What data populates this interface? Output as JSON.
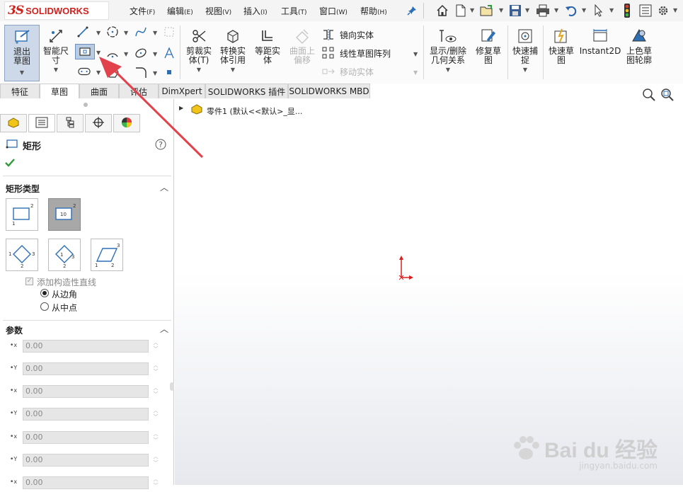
{
  "app": {
    "logo_ds": "3S",
    "logo_word": "SOLIDWORKS"
  },
  "menu": [
    {
      "label": "文件",
      "key": "(F)"
    },
    {
      "label": "编辑",
      "key": "(E)"
    },
    {
      "label": "视图",
      "key": "(V)"
    },
    {
      "label": "插入",
      "key": "(I)"
    },
    {
      "label": "工具",
      "key": "(T)"
    },
    {
      "label": "窗口",
      "key": "(W)"
    },
    {
      "label": "帮助",
      "key": "(H)"
    }
  ],
  "ribbon": {
    "exit_sketch": "退出草图",
    "smart_dim": "智能尺寸",
    "trim": "剪裁实体(T)",
    "convert": "转换实体引用",
    "offset": "等距实体",
    "offset_surface": "曲面上偏移",
    "mirror": "镜向实体",
    "linear_pattern": "线性草图阵列",
    "move": "移动实体",
    "display_relations": "显示/删除几何关系",
    "repair": "修复草图",
    "quick_snaps": "快速捕捉",
    "rapid_sketch": "快速草图",
    "instant2d": "Instant2D",
    "shaded_contours": "上色草图轮廓"
  },
  "tabs": [
    "特征",
    "草图",
    "曲面",
    "评估",
    "DimXpert",
    "SOLIDWORKS 插件",
    "SOLIDWORKS MBD"
  ],
  "tree": {
    "part_label": "零件1  (默认<<默认>_显..."
  },
  "panel": {
    "title": "矩形",
    "rect_type_title": "矩形类型",
    "construction_lines": "添加构造性直线",
    "from_corner": "从边角",
    "from_midpoint": "从中点",
    "params_title": "参数",
    "params": [
      {
        "axis": "x",
        "value": "0.00"
      },
      {
        "axis": "Y",
        "value": "0.00"
      },
      {
        "axis": "x",
        "value": "0.00"
      },
      {
        "axis": "Y",
        "value": "0.00"
      },
      {
        "axis": "x",
        "value": "0.00"
      },
      {
        "axis": "Y",
        "value": "0.00"
      },
      {
        "axis": "x",
        "value": "0.00"
      }
    ]
  },
  "watermark": {
    "brand": "Bai du 经验",
    "url": "jingyan.baidu.com"
  },
  "colors": {
    "accent_red": "#d0211c",
    "selection_blue": "#2a6fb0",
    "arrow_red": "#e2424b"
  }
}
